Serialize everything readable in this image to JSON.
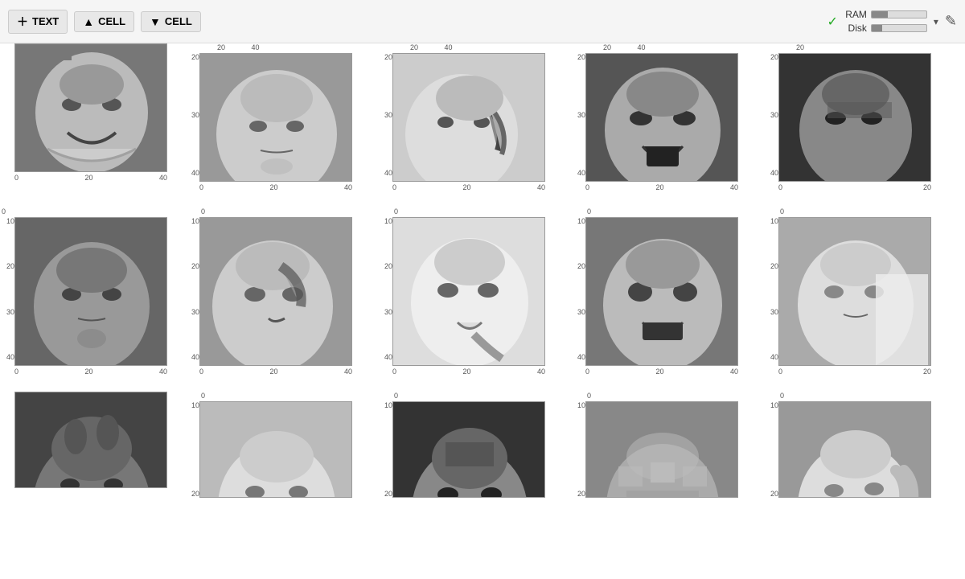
{
  "toolbar": {
    "text_button": "TEXT",
    "cell_up_button": "CELL",
    "cell_down_button": "CELL",
    "ram_label": "RAM",
    "disk_label": "Disk",
    "ram_fill": "30%",
    "disk_fill": "20%"
  },
  "grid": {
    "axis_values_x": [
      "0",
      "20",
      "40"
    ],
    "axis_values_y_top": [
      "20",
      "30",
      "40"
    ],
    "axis_values_y_mid": [
      "0",
      "10",
      "20",
      "30",
      "40"
    ],
    "rows": [
      {
        "type": "partial-top",
        "cells": [
          {
            "id": 1,
            "alt": "face laughing",
            "class": "face-1"
          },
          {
            "id": 2,
            "alt": "face neutral",
            "class": "face-2"
          },
          {
            "id": 3,
            "alt": "face hand gesture",
            "class": "face-3"
          },
          {
            "id": 4,
            "alt": "face mouth open",
            "class": "face-4"
          },
          {
            "id": 5,
            "alt": "face side",
            "class": "face-5"
          }
        ]
      },
      {
        "type": "full",
        "cells": [
          {
            "id": 6,
            "alt": "face stern",
            "class": "face-6"
          },
          {
            "id": 7,
            "alt": "face phone",
            "class": "face-7"
          },
          {
            "id": 8,
            "alt": "face thinking",
            "class": "face-8"
          },
          {
            "id": 9,
            "alt": "face surprised",
            "class": "face-9"
          },
          {
            "id": 10,
            "alt": "face side light",
            "class": "face-10"
          }
        ]
      },
      {
        "type": "partial-bottom",
        "cells": [
          {
            "id": 11,
            "alt": "face looking down",
            "class": "face-11"
          },
          {
            "id": 12,
            "alt": "face neutral 2",
            "class": "face-12"
          },
          {
            "id": 13,
            "alt": "face dark hair",
            "class": "face-13"
          },
          {
            "id": 14,
            "alt": "face blurry",
            "class": "face-14"
          },
          {
            "id": 15,
            "alt": "face partial",
            "class": "face-15"
          }
        ]
      }
    ]
  }
}
